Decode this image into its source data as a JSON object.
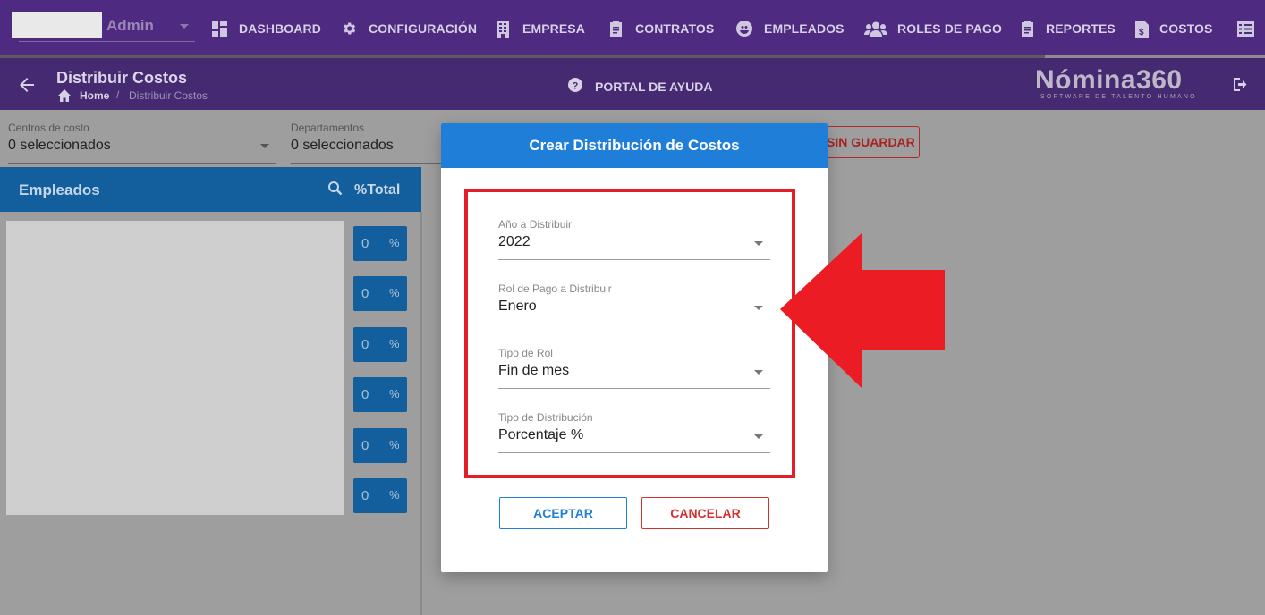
{
  "topnav": {
    "user_role": "Admin",
    "items": [
      {
        "label": "DASHBOARD",
        "icon": "dashboard-icon"
      },
      {
        "label": "CONFIGURACIÓN",
        "icon": "gear-icon"
      },
      {
        "label": "EMPRESA",
        "icon": "building-icon"
      },
      {
        "label": "CONTRATOS",
        "icon": "clipboard-icon"
      },
      {
        "label": "EMPLEADOS",
        "icon": "people-face-icon"
      },
      {
        "label": "ROLES DE PAGO",
        "icon": "users-icon"
      },
      {
        "label": "REPORTES",
        "icon": "report-icon"
      },
      {
        "label": "COSTOS",
        "icon": "dollar-file-icon"
      },
      {
        "label": "",
        "icon": "list-icon"
      }
    ]
  },
  "subheader": {
    "title": "Distribuir Costos",
    "breadcrumb_home": "Home",
    "breadcrumb_sep": "/",
    "breadcrumb_current": "Distribuir Costos",
    "help_label": "PORTAL DE AYUDA",
    "brand": "Nómina360",
    "brand_sub": "SOFTWARE DE TALENTO HUMANO"
  },
  "filters": {
    "cost_centers_label": "Centros de costo",
    "cost_centers_value": "0 seleccionados",
    "departments_label": "Departamentos",
    "departments_value": "0 seleccionados",
    "save_label": "SIN GUARDAR"
  },
  "employees": {
    "title": "Empleados",
    "total_label": "%Total",
    "rows": [
      {
        "value": "0",
        "unit": "%"
      },
      {
        "value": "0",
        "unit": "%"
      },
      {
        "value": "0",
        "unit": "%"
      },
      {
        "value": "0",
        "unit": "%"
      },
      {
        "value": "0",
        "unit": "%"
      },
      {
        "value": "0",
        "unit": "%"
      }
    ]
  },
  "modal": {
    "title": "Crear Distribución de Costos",
    "fields": [
      {
        "label": "Año a Distribuir",
        "value": "2022"
      },
      {
        "label": "Rol de Pago a Distribuir",
        "value": "Enero"
      },
      {
        "label": "Tipo de Rol",
        "value": "Fin de mes"
      },
      {
        "label": "Tipo de Distribución",
        "value": "Porcentaje %"
      }
    ],
    "accept_label": "ACEPTAR",
    "cancel_label": "CANCELAR"
  },
  "colors": {
    "nav_bg": "#4e2a80",
    "modal_header": "#1f7fd8",
    "highlight": "#e41e26",
    "panel_blue": "#135e9c"
  }
}
